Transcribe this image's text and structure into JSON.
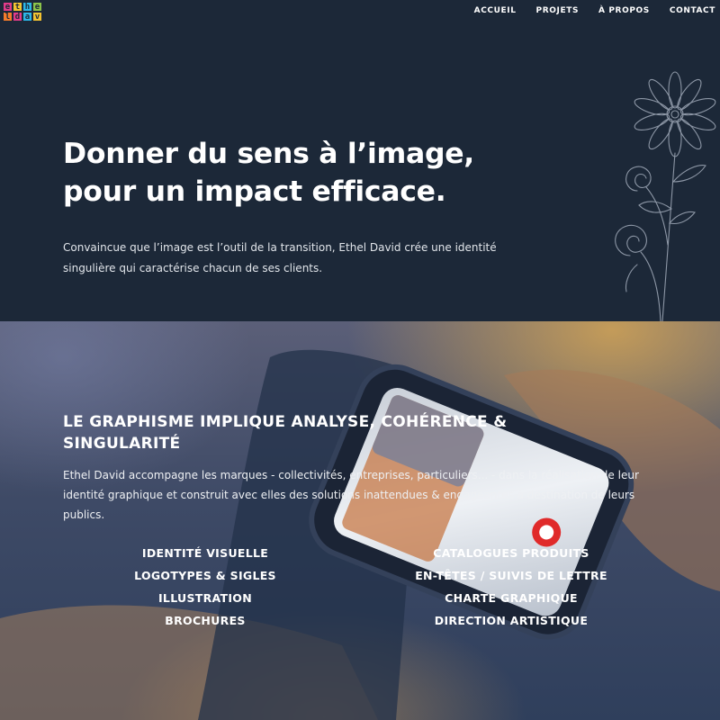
{
  "logo": {
    "letters": [
      "e",
      "t",
      "h",
      "e",
      "l",
      "d",
      "a",
      "v"
    ],
    "colors": [
      "#e23b8a",
      "#f2c230",
      "#2bb6e8",
      "#8bc34a",
      "#f57c2a",
      "#e23b8a",
      "#2bb6e8",
      "#f2c230"
    ]
  },
  "nav": {
    "items": [
      "ACCUEIL",
      "PROJETS",
      "À PROPOS",
      "CONTACT"
    ]
  },
  "hero": {
    "title_line1": "Donner du sens à l’image,",
    "title_line2": "pour un impact efficace.",
    "text": "Convaincue que l’image est l’outil de la transition, Ethel David crée une identité singulière qui caractérise chacun de ses clients."
  },
  "services": {
    "title_line1": "LE GRAPHISME IMPLIQUE ANALYSE, COHÉRENCE &",
    "title_line2": "SINGULARITÉ",
    "text": "Ethel David accompagne les marques - collectivités, entreprises, particuliers... - dans la réalisation de leur identité graphique et construit avec elles des solutions inattendues & engageantes à destination de leurs publics.",
    "left_items": [
      "IDENTITÉ VISUELLE",
      "LOGOTYPES & SIGLES",
      "ILLUSTRATION",
      "BROCHURES"
    ],
    "right_items": [
      "CATALOGUES PRODUITS",
      "EN-TÊTES / SUIVIS DE LETTRE",
      "CHARTE GRAPHIQUE",
      "DIRECTION ARTISTIQUE"
    ]
  },
  "colors": {
    "background": "#1c2838",
    "text": "#ffffff"
  }
}
